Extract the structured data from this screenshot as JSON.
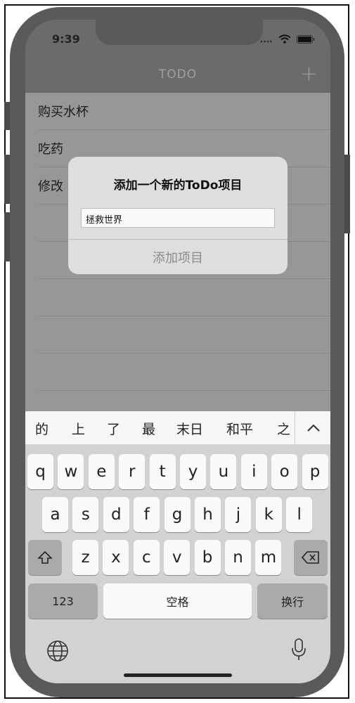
{
  "status": {
    "time": "9:39"
  },
  "nav": {
    "title": "TODO",
    "add_label": "+"
  },
  "todo_items": [
    "购买水杯",
    "吃药",
    "修改"
  ],
  "dialog": {
    "title": "添加一个新的ToDo项目",
    "input_value": "拯救世界",
    "action_label": "添加项目"
  },
  "keyboard": {
    "candidates": [
      "的",
      "上",
      "了",
      "最",
      "末日",
      "和平",
      "之"
    ],
    "row1": [
      "q",
      "w",
      "e",
      "r",
      "t",
      "y",
      "u",
      "i",
      "o",
      "p"
    ],
    "row2": [
      "a",
      "s",
      "d",
      "f",
      "g",
      "h",
      "j",
      "k",
      "l"
    ],
    "row3": [
      "z",
      "x",
      "c",
      "v",
      "b",
      "n",
      "m"
    ],
    "numbers_label": "123",
    "space_label": "空格",
    "return_label": "换行"
  },
  "icons": {
    "shift": "shift-icon",
    "delete": "backspace-icon",
    "globe": "globe-icon",
    "mic": "microphone-icon",
    "chevron": "chevron-up-icon"
  }
}
